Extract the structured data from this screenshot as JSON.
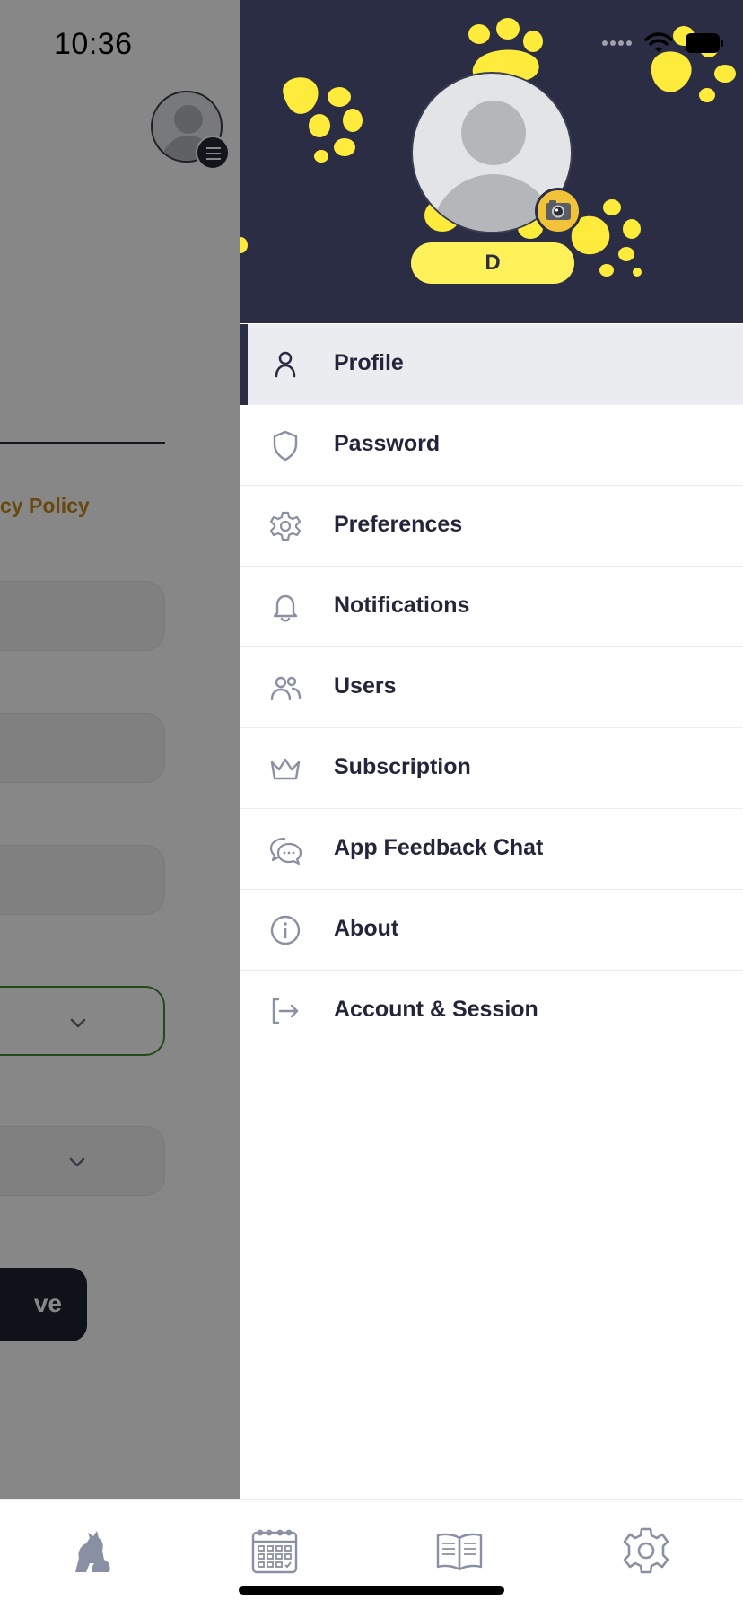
{
  "status_bar": {
    "time": "10:36"
  },
  "background_screen": {
    "policy_link": "cy Policy",
    "save_button_label": "ve"
  },
  "drawer": {
    "user_initial": "D",
    "menu": [
      {
        "label": "Profile",
        "icon": "person-icon",
        "active": true
      },
      {
        "label": "Password",
        "icon": "shield-icon",
        "active": false
      },
      {
        "label": "Preferences",
        "icon": "gear-icon",
        "active": false
      },
      {
        "label": "Notifications",
        "icon": "bell-icon",
        "active": false
      },
      {
        "label": "Users",
        "icon": "users-icon",
        "active": false
      },
      {
        "label": "Subscription",
        "icon": "crown-icon",
        "active": false
      },
      {
        "label": "App Feedback Chat",
        "icon": "chat-bubbles-icon",
        "active": false
      },
      {
        "label": "About",
        "icon": "info-icon",
        "active": false
      },
      {
        "label": "Account & Session",
        "icon": "logout-icon",
        "active": false
      }
    ]
  },
  "tab_bar": {
    "tabs": [
      {
        "icon": "pets-icon"
      },
      {
        "icon": "calendar-icon"
      },
      {
        "icon": "book-icon"
      },
      {
        "icon": "gear-icon"
      }
    ]
  },
  "colors": {
    "header_bg": "#2b2d45",
    "accent_yellow": "#fff15a",
    "paw_yellow": "#ffeb3b",
    "policy_link": "#c58a1a",
    "active_row_bg": "#ebecef",
    "text_dark": "#23253a",
    "icon_gray": "#8a90a3"
  }
}
